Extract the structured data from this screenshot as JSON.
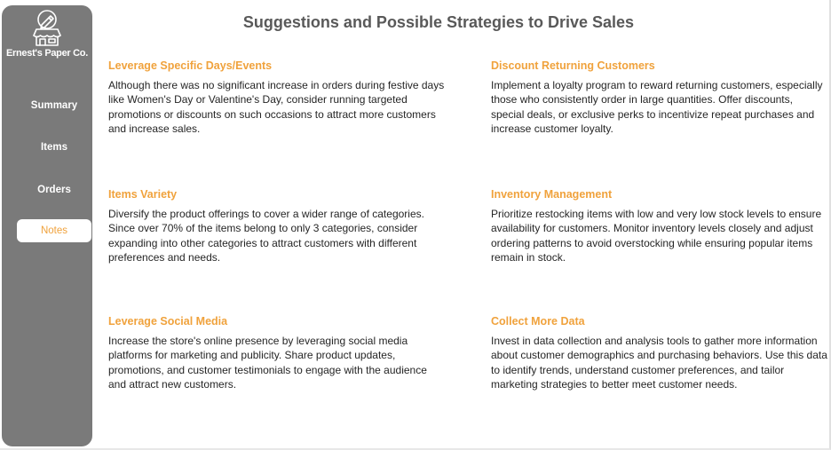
{
  "sidebar": {
    "company": "Ernest's Paper Co.",
    "logo_icon": "shop-pencil-icon",
    "nav": [
      {
        "label": "Summary",
        "active": false
      },
      {
        "label": "Items",
        "active": false
      },
      {
        "label": "Orders",
        "active": false
      },
      {
        "label": "Notes",
        "active": true
      }
    ]
  },
  "page_title": "Suggestions and Possible Strategies to Drive Sales",
  "cards": [
    {
      "title": "Leverage Specific Days/Events",
      "body": "Although there was no significant increase in orders during festive days like Women's Day or Valentine's Day, consider running targeted promotions or discounts on such occasions to attract more customers and increase sales."
    },
    {
      "title": "Discount Returning Customers",
      "body": "Implement a loyalty program to reward returning customers, especially those who consistently order in large quantities. Offer discounts, special deals, or exclusive perks to incentivize repeat purchases and increase customer loyalty."
    },
    {
      "title": "Items Variety",
      "body": "Diversify the product offerings to cover a wider range of categories. Since over 70% of the items belong to only 3 categories, consider expanding into other categories to attract customers with different preferences and needs."
    },
    {
      "title": "Inventory Management",
      "body": "Prioritize restocking items with low and very low stock levels to ensure availability for customers. Monitor inventory levels closely and adjust ordering patterns to avoid overstocking while ensuring popular items remain in stock."
    },
    {
      "title": "Leverage Social Media",
      "body": "Increase the store's online presence by leveraging social media platforms for marketing and publicity. Share product updates, promotions, and customer testimonials to engage with the audience and attract new customers."
    },
    {
      "title": "Collect More Data",
      "body": "Invest in data collection and analysis tools to gather more information about customer demographics and purchasing behaviors. Use this data to identify trends, understand customer preferences, and tailor marketing strategies to better meet customer needs."
    }
  ],
  "colors": {
    "accent": "#f0a23c",
    "sidebar": "#7a7a7a",
    "title": "#595959"
  }
}
